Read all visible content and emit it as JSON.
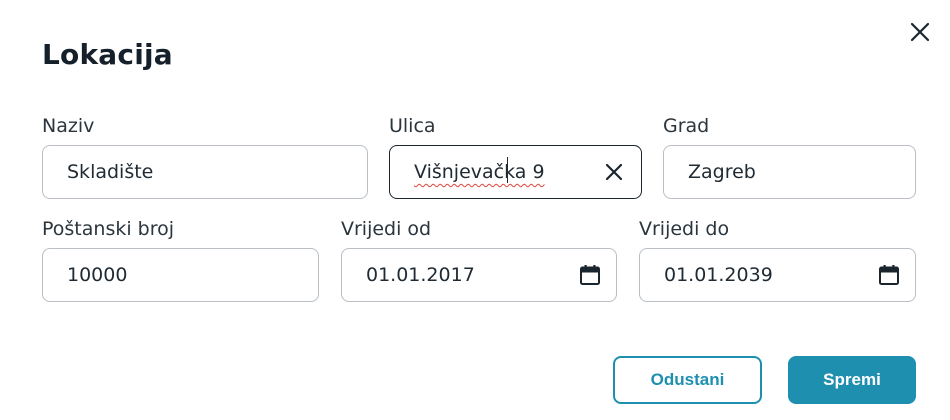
{
  "dialog": {
    "title": "Lokacija",
    "close_icon": "close-icon"
  },
  "fields": {
    "naziv": {
      "label": "Naziv",
      "value": "Skladište"
    },
    "ulica": {
      "label": "Ulica",
      "value": "Višnjevačka 9",
      "clear_icon": "clear-icon"
    },
    "grad": {
      "label": "Grad",
      "value": "Zagreb"
    },
    "postanski_broj": {
      "label": "Poštanski broj",
      "value": "10000"
    },
    "vrijedi_od": {
      "label": "Vrijedi od",
      "value": "01.01.2017",
      "icon": "calendar-icon"
    },
    "vrijedi_do": {
      "label": "Vrijedi do",
      "value": "01.01.2039",
      "icon": "calendar-icon"
    }
  },
  "actions": {
    "cancel_label": "Odustani",
    "save_label": "Spremi"
  },
  "colors": {
    "accent": "#1f8fb0",
    "text": "#1f2a33",
    "border": "#b9bfc5",
    "spellcheck": "#e0453e"
  }
}
